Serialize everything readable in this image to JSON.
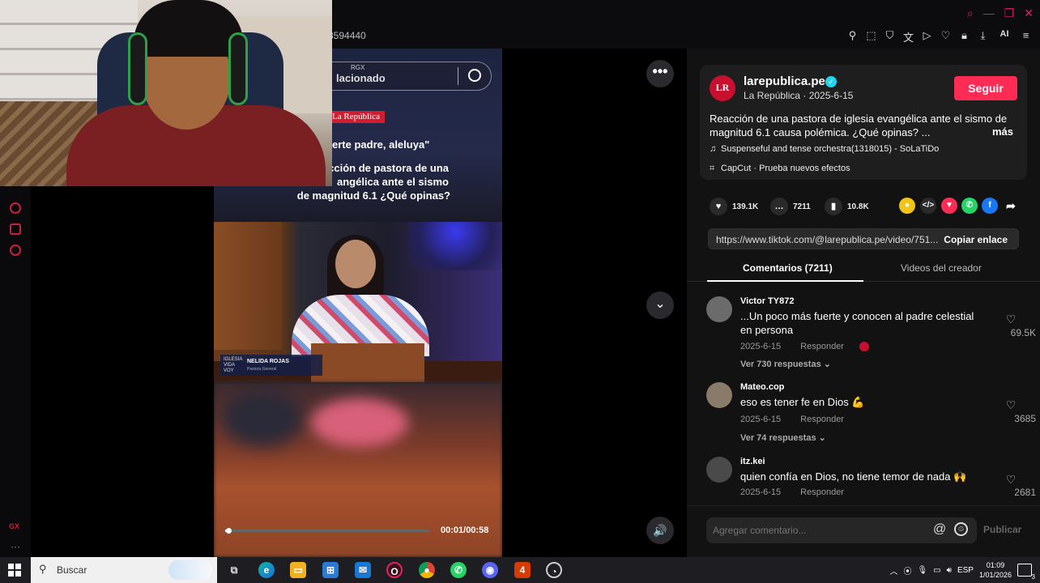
{
  "browser": {
    "url_fragment": "3594440",
    "window_controls": [
      "search-icon",
      "minimize-icon",
      "restore-icon",
      "close-icon"
    ],
    "toolbar_icons": [
      "pin-icon",
      "snapshot-icon",
      "shield-icon",
      "translate-icon",
      "play-icon",
      "heart-icon",
      "lock-icon",
      "download-icon",
      "ai-icon",
      "menu-icon"
    ],
    "ai_label": "AI"
  },
  "sidebar": {
    "icons": [
      "history-icon",
      "extensions-icon",
      "settings-icon"
    ],
    "gx_label": "GX",
    "more_label": "···"
  },
  "video": {
    "search_rgx": "RGX",
    "search_text": "lacionado",
    "source_tag": "La República",
    "quote": "erte padre, aleluya\"",
    "caption": [
      "cción de pastora de una",
      "angélica ante el sismo",
      "de magnitud 6.1 ¿Qué opinas?"
    ],
    "lower_third_logo": "IGLESIA VIDA VOY",
    "lower_third_name": "NELIDA ROJAS",
    "lower_third_role": "Pastora General",
    "progress": 0.017,
    "time": "00:01/00:58"
  },
  "controls": {
    "more_label": "•••",
    "down_label": "⌄",
    "volume_label": "🔊"
  },
  "post": {
    "avatar_text": "LR",
    "author": "larepublica.pe",
    "verified": "✓",
    "author_sub": "La República · 2025-6-15",
    "follow_label": "Seguir",
    "description": "Reacción de una pastora de iglesia evangélica ante el sismo de magnitud 6.1 causa polémica. ¿Qué opinas? ...",
    "more_label": "más",
    "music": "Suspenseful and tense orchestra(1318015) - SoLaTiDo",
    "effect": "CapCut · Prueba nuevos efectos",
    "likes": "139.1K",
    "comments": "7211",
    "saves": "10.8K",
    "link": "https://www.tiktok.com/@larepublica.pe/video/751...",
    "copy_label": "Copiar enlace"
  },
  "tabs": {
    "comments": "Comentarios (7211)",
    "creator_videos": "Videos del creador"
  },
  "comments": [
    {
      "user": "Victor TY872",
      "text": "...Un poco más fuerte y conocen al padre celestial en persona",
      "date": "2025-6-15",
      "reply": "Responder",
      "replies": "Ver 730 respuestas ⌄",
      "likes": "69.5K"
    },
    {
      "user": "Mateo.cop",
      "text": "eso es tener fe en Dios 💪",
      "date": "2025-6-15",
      "reply": "Responder",
      "replies": "Ver 74 respuestas ⌄",
      "likes": "3685"
    },
    {
      "user": "itz.kei",
      "text": "quien confía en Dios, no tiene temor de nada 🙌",
      "date": "2025-6-15",
      "reply": "Responder",
      "replies": "",
      "likes": "2681"
    }
  ],
  "comment_bar": {
    "placeholder": "Agregar comentario...",
    "at_label": "@",
    "emoji_label": "☺",
    "publish_label": "Publicar"
  },
  "taskbar": {
    "search_label": "Buscar",
    "apps": [
      "task-view-icon",
      "edge-icon",
      "file-explorer-icon",
      "store-icon",
      "mail-icon",
      "opera-gx-icon",
      "chrome-icon",
      "whatsapp-icon",
      "discord-icon",
      "app-4-icon",
      "capture-icon"
    ],
    "app_4_label": "4",
    "language": "ESP",
    "time": "01:09",
    "date": "1/01/2026",
    "notification_count": "3"
  }
}
